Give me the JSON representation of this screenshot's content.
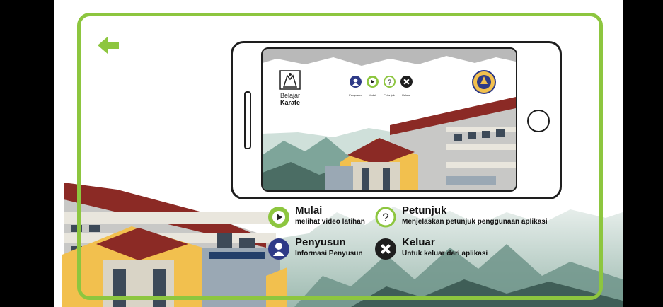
{
  "app": {
    "title_line1": "Belajar",
    "title_line2": "Karate"
  },
  "colors": {
    "accent": "#8dc63f",
    "navy": "#2e3a87",
    "dark": "#1e1e1e"
  },
  "icons": {
    "back": "arrow-left-icon",
    "mulai": "play-icon",
    "petunjuk": "question-icon",
    "penyusun": "person-icon",
    "keluar": "close-icon"
  },
  "phone_screen": {
    "buttons": [
      {
        "label": "Penyusun"
      },
      {
        "label": "Mulai"
      },
      {
        "label": "Petunjuk"
      },
      {
        "label": "Keluar"
      }
    ]
  },
  "legend": [
    {
      "title": "Mulai",
      "desc": "melihat video latihan"
    },
    {
      "title": "Petunjuk",
      "desc": "Menjelaskan petunjuk penggunaan aplikasi"
    },
    {
      "title": "Penyusun",
      "desc": "Informasi Penyusun"
    },
    {
      "title": "Keluar",
      "desc": "Untuk keluar dari aplikasi"
    }
  ]
}
